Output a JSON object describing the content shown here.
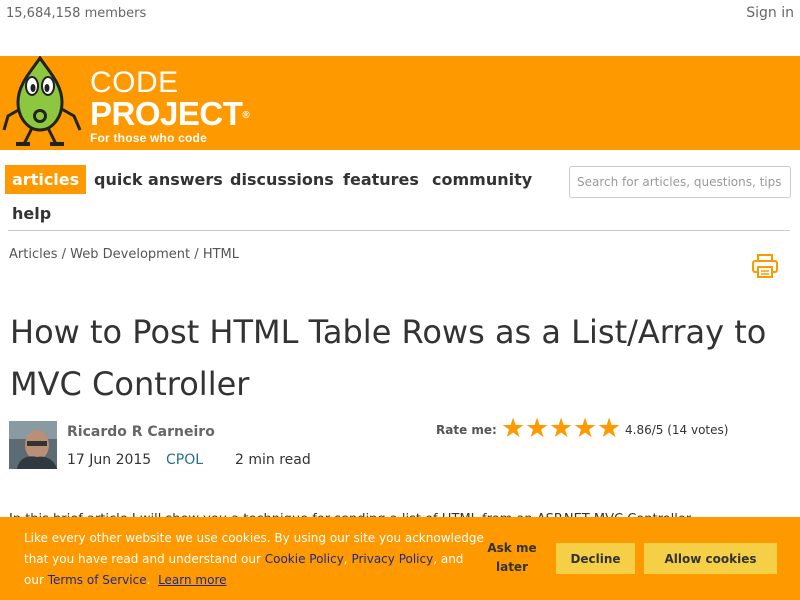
{
  "topbar": {
    "members": "15,684,158 members",
    "signin": "Sign in"
  },
  "brand": {
    "code": "CODE",
    "project": "PROJECT",
    "reg": "®",
    "tagline": "For those who code",
    "color": "#ff9900"
  },
  "nav": {
    "items": [
      "articles",
      "quick answers",
      "discussions",
      "features",
      "community",
      "help"
    ],
    "active": "articles",
    "search_placeholder": "Search for articles, questions, tips"
  },
  "breadcrumb": {
    "items": [
      "Articles",
      "Web Development",
      "HTML"
    ],
    "separator": "/"
  },
  "article": {
    "title": "How to Post HTML Table Rows as a List/Array to MVC Controller",
    "author": "Ricardo R Carneiro",
    "date": "17 Jun 2015",
    "license": "CPOL",
    "read_time": "2 min read",
    "rate_label": "Rate me:",
    "rating_stars": 5,
    "rating_text": "4.86/5 (14 votes)",
    "body_peek": "In this brief article I will show you a technique for sending a list of HTML from an ASP.NET MVC Controller."
  },
  "cookie": {
    "text_1": "Like every other website we use cookies. By using our site you acknowledge that you have read and understand our ",
    "cookie_policy": "Cookie Policy",
    "comma": ", ",
    "privacy_policy": "Privacy Policy",
    "and_our": ", and our ",
    "terms": "Terms of Service",
    "period": ".",
    "learn_more": "Learn more",
    "ask_later": "Ask me later",
    "decline": "Decline",
    "allow": "Allow cookies",
    "button_color": "#f5cf46"
  }
}
